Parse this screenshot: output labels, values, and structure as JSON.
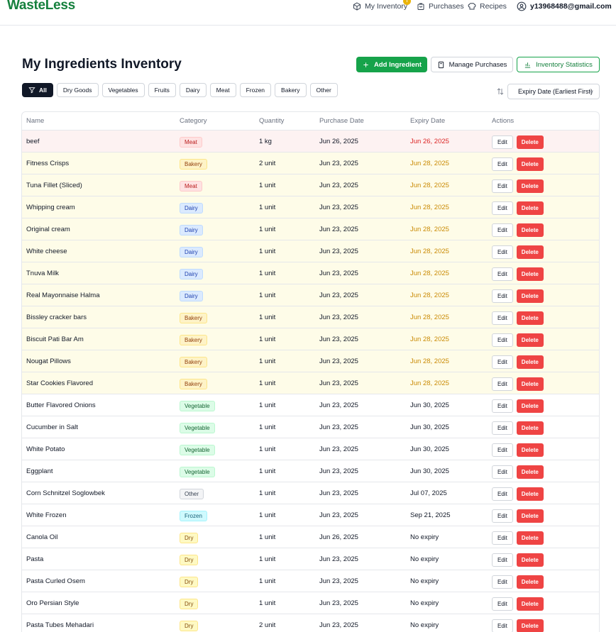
{
  "header": {
    "logo": "WasteLess",
    "nav_inventory": "My Inventory",
    "nav_inventory_badge": "!",
    "nav_purchases": "Purchases",
    "nav_recipes": "Recipes",
    "user_email": "y13968488@gmail.com"
  },
  "page": {
    "title": "My Ingredients Inventory",
    "add_button": "Add Ingredient",
    "manage_button": "Manage Purchases",
    "stats_button": "Inventory Statistics"
  },
  "filters": [
    "All",
    "Dry Goods",
    "Vegetables",
    "Fruits",
    "Dairy",
    "Meat",
    "Frozen",
    "Bakery",
    "Other"
  ],
  "sort": {
    "selected": "Expiry Date (Earliest First)"
  },
  "table": {
    "headers": {
      "name": "Name",
      "category": "Category",
      "quantity": "Quantity",
      "purchase_date": "Purchase Date",
      "expiry_date": "Expiry Date",
      "actions": "Actions"
    },
    "edit_label": "Edit",
    "delete_label": "Delete",
    "rows": [
      {
        "name": "beef",
        "category": "Meat",
        "cat_class": "tag-meat",
        "quantity": "1 kg",
        "purchase": "Jun 26, 2025",
        "expiry": "Jun 26, 2025",
        "status": "expired"
      },
      {
        "name": "Fitness Crisps",
        "category": "Bakery",
        "cat_class": "tag-bakery",
        "quantity": "2 unit",
        "purchase": "Jun 23, 2025",
        "expiry": "Jun 28, 2025",
        "status": "soon"
      },
      {
        "name": "Tuna Fillet (Sliced)",
        "category": "Meat",
        "cat_class": "tag-meat",
        "quantity": "1 unit",
        "purchase": "Jun 23, 2025",
        "expiry": "Jun 28, 2025",
        "status": "soon"
      },
      {
        "name": "Whipping cream",
        "category": "Dairy",
        "cat_class": "tag-dairy",
        "quantity": "1 unit",
        "purchase": "Jun 23, 2025",
        "expiry": "Jun 28, 2025",
        "status": "soon"
      },
      {
        "name": "Original cream",
        "category": "Dairy",
        "cat_class": "tag-dairy",
        "quantity": "1 unit",
        "purchase": "Jun 23, 2025",
        "expiry": "Jun 28, 2025",
        "status": "soon"
      },
      {
        "name": "White cheese",
        "category": "Dairy",
        "cat_class": "tag-dairy",
        "quantity": "1 unit",
        "purchase": "Jun 23, 2025",
        "expiry": "Jun 28, 2025",
        "status": "soon"
      },
      {
        "name": "Tnuva Milk",
        "category": "Dairy",
        "cat_class": "tag-dairy",
        "quantity": "1 unit",
        "purchase": "Jun 23, 2025",
        "expiry": "Jun 28, 2025",
        "status": "soon"
      },
      {
        "name": "Real Mayonnaise Halma",
        "category": "Dairy",
        "cat_class": "tag-dairy",
        "quantity": "1 unit",
        "purchase": "Jun 23, 2025",
        "expiry": "Jun 28, 2025",
        "status": "soon"
      },
      {
        "name": "Bissley cracker bars",
        "category": "Bakery",
        "cat_class": "tag-bakery",
        "quantity": "1 unit",
        "purchase": "Jun 23, 2025",
        "expiry": "Jun 28, 2025",
        "status": "soon"
      },
      {
        "name": "Biscuit Pati Bar Am",
        "category": "Bakery",
        "cat_class": "tag-bakery",
        "quantity": "1 unit",
        "purchase": "Jun 23, 2025",
        "expiry": "Jun 28, 2025",
        "status": "soon"
      },
      {
        "name": "Nougat Pillows",
        "category": "Bakery",
        "cat_class": "tag-bakery",
        "quantity": "1 unit",
        "purchase": "Jun 23, 2025",
        "expiry": "Jun 28, 2025",
        "status": "soon"
      },
      {
        "name": "Star Cookies Flavored",
        "category": "Bakery",
        "cat_class": "tag-bakery",
        "quantity": "1 unit",
        "purchase": "Jun 23, 2025",
        "expiry": "Jun 28, 2025",
        "status": "soon"
      },
      {
        "name": "Butter Flavored Onions",
        "category": "Vegetable",
        "cat_class": "tag-veg",
        "quantity": "1 unit",
        "purchase": "Jun 23, 2025",
        "expiry": "Jun 30, 2025",
        "status": "normal"
      },
      {
        "name": "Cucumber in Salt",
        "category": "Vegetable",
        "cat_class": "tag-veg",
        "quantity": "1 unit",
        "purchase": "Jun 23, 2025",
        "expiry": "Jun 30, 2025",
        "status": "normal"
      },
      {
        "name": "White Potato",
        "category": "Vegetable",
        "cat_class": "tag-veg",
        "quantity": "1 unit",
        "purchase": "Jun 23, 2025",
        "expiry": "Jun 30, 2025",
        "status": "normal"
      },
      {
        "name": "Eggplant",
        "category": "Vegetable",
        "cat_class": "tag-veg",
        "quantity": "1 unit",
        "purchase": "Jun 23, 2025",
        "expiry": "Jun 30, 2025",
        "status": "normal"
      },
      {
        "name": "Corn Schnitzel Soglowbek",
        "category": "Other",
        "cat_class": "tag-other",
        "quantity": "1 unit",
        "purchase": "Jun 23, 2025",
        "expiry": "Jul 07, 2025",
        "status": "normal"
      },
      {
        "name": "White Frozen",
        "category": "Frozen",
        "cat_class": "tag-frozen",
        "quantity": "1 unit",
        "purchase": "Jun 23, 2025",
        "expiry": "Sep 21, 2025",
        "status": "normal"
      },
      {
        "name": "Canola Oil",
        "category": "Dry",
        "cat_class": "tag-dry",
        "quantity": "1 unit",
        "purchase": "Jun 26, 2025",
        "expiry": "No expiry",
        "status": "normal"
      },
      {
        "name": "Pasta",
        "category": "Dry",
        "cat_class": "tag-dry",
        "quantity": "1 unit",
        "purchase": "Jun 23, 2025",
        "expiry": "No expiry",
        "status": "normal"
      },
      {
        "name": "Pasta Curled Osem",
        "category": "Dry",
        "cat_class": "tag-dry",
        "quantity": "1 unit",
        "purchase": "Jun 23, 2025",
        "expiry": "No expiry",
        "status": "normal"
      },
      {
        "name": "Oro Persian Style",
        "category": "Dry",
        "cat_class": "tag-dry",
        "quantity": "1 unit",
        "purchase": "Jun 23, 2025",
        "expiry": "No expiry",
        "status": "normal"
      },
      {
        "name": "Pasta Tubes Mehadari",
        "category": "Dry",
        "cat_class": "tag-dry",
        "quantity": "2 unit",
        "purchase": "Jun 23, 2025",
        "expiry": "No expiry",
        "status": "normal"
      }
    ]
  }
}
